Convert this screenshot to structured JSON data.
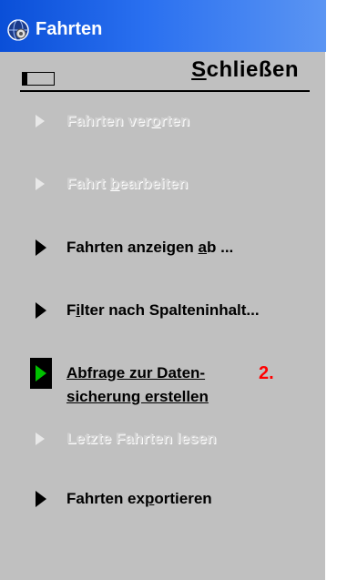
{
  "window": {
    "title": "Fahrten",
    "icon": "globe-gear-icon"
  },
  "closebar": {
    "label_pre": "",
    "label_ul": "S",
    "label_post": "chließen",
    "icon": "close-window-icon"
  },
  "menu": {
    "item1": {
      "pre": "Fahrten ver",
      "ul": "o",
      "post": "rten",
      "enabled": false
    },
    "item2": {
      "pre": "Fahrt ",
      "ul": "b",
      "post": "earbeiten",
      "enabled": false
    },
    "item3": {
      "pre": "Fahrten anzeigen ",
      "ul": "a",
      "post": "b ...",
      "enabled": true
    },
    "item4": {
      "pre": "F",
      "ul": "i",
      "post": "lter nach Spalteninhalt...",
      "enabled": true
    },
    "item5": {
      "line1": "Abfrage zur Daten-",
      "line2": "sicherung erstellen",
      "enabled": true,
      "active": true
    },
    "item6": {
      "pre": "Letzte Fahrten lesen",
      "enabled": false
    },
    "item7": {
      "pre": "Fahrten ex",
      "ul": "p",
      "post": "ortieren",
      "enabled": true
    }
  },
  "annotation": {
    "text": "2.",
    "color": "#ff0000"
  },
  "colors": {
    "panel": "#c0c0c0",
    "titlebar": "#2a70f0",
    "active_arrow": "#00c000",
    "disabled_text": "#d0d0d0"
  }
}
